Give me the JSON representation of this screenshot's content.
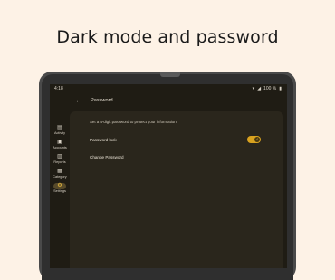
{
  "headline": "Dark mode and password",
  "status_bar": {
    "time": "4:18",
    "battery": "100 %"
  },
  "topbar": {
    "title": "Password",
    "back_icon": "arrow-left-icon"
  },
  "rail": [
    {
      "label": "Activity",
      "icon": "list-icon",
      "active": false
    },
    {
      "label": "Accounts",
      "icon": "wallet-icon",
      "active": false
    },
    {
      "label": "Reports",
      "icon": "chart-icon",
      "active": false
    },
    {
      "label": "Category",
      "icon": "category-icon",
      "active": false
    },
    {
      "label": "Settings",
      "icon": "gear-icon",
      "active": true
    }
  ],
  "content": {
    "description": "Set a 4-digit password to protect your information.",
    "password_lock_label": "Password lock",
    "password_lock_on": true,
    "change_password_label": "Change Password"
  },
  "colors": {
    "background": "#fdf2e6",
    "screen": "#1f1c14",
    "accent": "#d9a21f"
  }
}
